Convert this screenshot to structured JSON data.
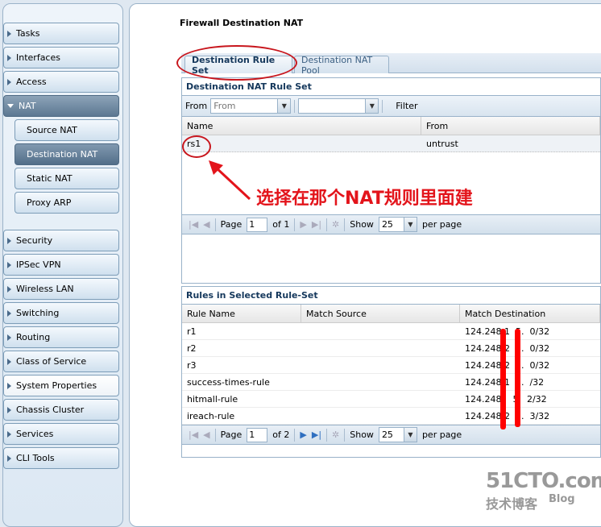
{
  "sidebar": {
    "items": [
      {
        "label": "Tasks"
      },
      {
        "label": "Interfaces"
      },
      {
        "label": "Access"
      },
      {
        "label": "NAT"
      },
      {
        "label": "Security"
      },
      {
        "label": "IPSec VPN"
      },
      {
        "label": "Wireless LAN"
      },
      {
        "label": "Switching"
      },
      {
        "label": "Routing"
      },
      {
        "label": "Class of Service"
      },
      {
        "label": "System Properties"
      },
      {
        "label": "Chassis Cluster"
      },
      {
        "label": "Services"
      },
      {
        "label": "CLI Tools"
      }
    ],
    "nat_sub": [
      {
        "label": "Source NAT"
      },
      {
        "label": "Destination NAT"
      },
      {
        "label": "Static NAT"
      },
      {
        "label": "Proxy ARP"
      }
    ]
  },
  "page_title": "Firewall Destination NAT",
  "tabs": [
    {
      "label": "Destination Rule Set"
    },
    {
      "label": "Destination NAT Pool"
    }
  ],
  "ruleset": {
    "title": "Destination NAT Rule Set",
    "from_label": "From",
    "from_placeholder": "From",
    "filter_label": "Filter",
    "columns": [
      "Name",
      "From"
    ],
    "rows": [
      [
        "rs1",
        "untrust"
      ]
    ],
    "pager": {
      "page_label": "Page",
      "page": "1",
      "of": "of 1",
      "show": "Show",
      "per_page_value": "25",
      "per_page": "per page"
    }
  },
  "rules": {
    "title": "Rules in Selected Rule-Set",
    "columns": [
      "Rule Name",
      "Match Source",
      "Match Destination"
    ],
    "rows": [
      [
        "r1",
        "",
        "124.248.1  5.  0/32"
      ],
      [
        "r2",
        "",
        "124.248.2  5.  0/32"
      ],
      [
        "r3",
        "",
        "124.248.2  5.  0/32"
      ],
      [
        "success-times-rule",
        "",
        "124.248.1  5.  /32"
      ],
      [
        "hitmall-rule",
        "",
        "124.248.   5.  2/32"
      ],
      [
        "ireach-rule",
        "",
        "124.248.2  5.  3/32"
      ]
    ],
    "pager": {
      "page_label": "Page",
      "page": "1",
      "of": "of 2",
      "show": "Show",
      "per_page_value": "25",
      "per_page": "per page"
    }
  },
  "annotation": "选择在那个NAT规则里面建",
  "watermark": {
    "line1": "51CTO.com",
    "line2": "技术博客",
    "line3": "Blog"
  },
  "colors": {
    "annotation": "#e3141b",
    "header_text": "#15385c"
  }
}
